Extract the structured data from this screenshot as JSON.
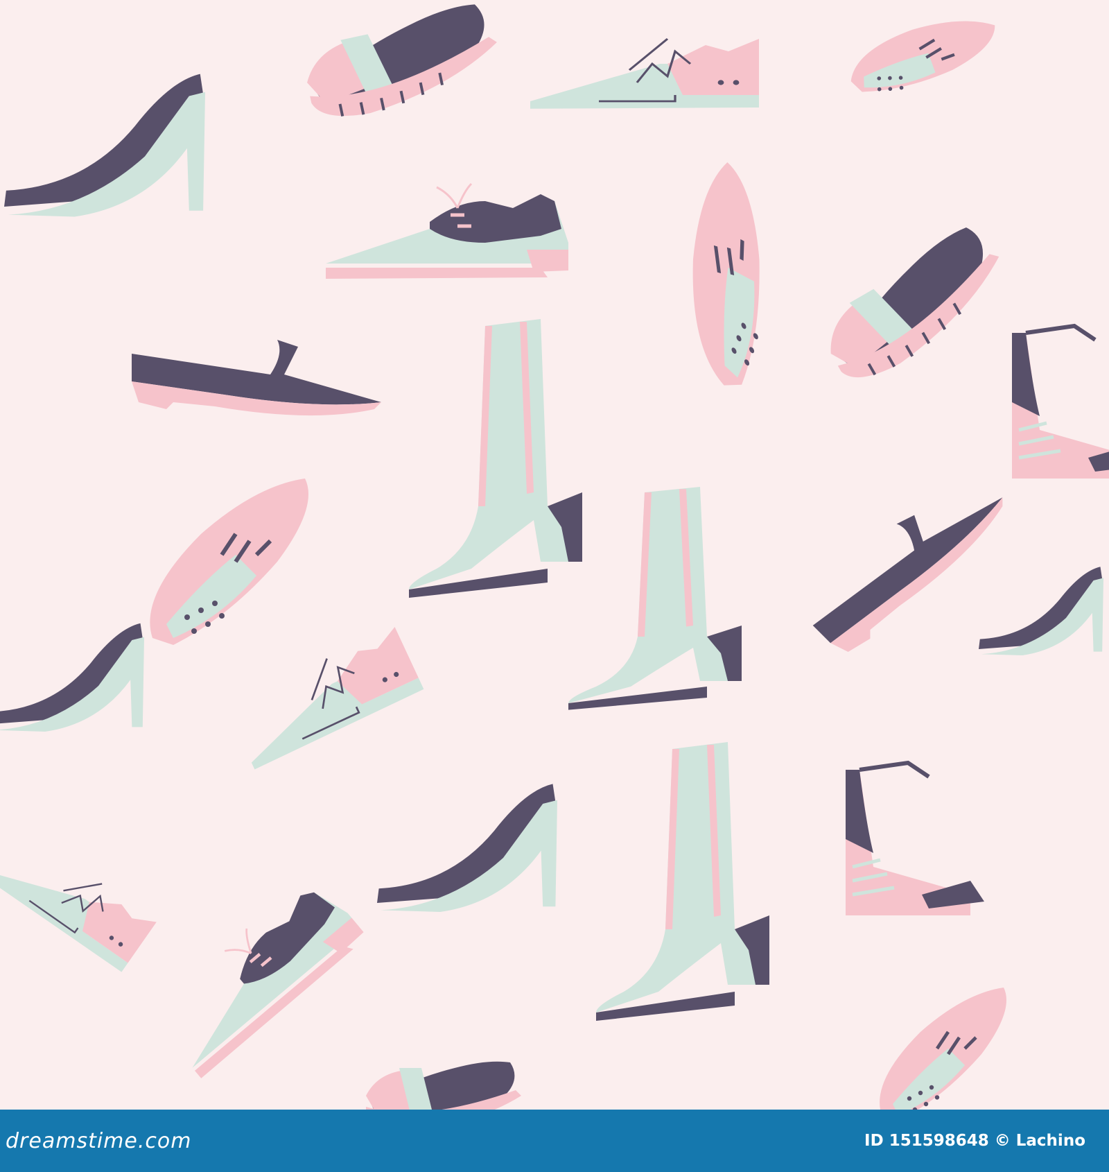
{
  "colors": {
    "background": "#fbeeee",
    "pink": "#f6c3cb",
    "mint": "#cfe4dc",
    "plum": "#58506a",
    "footer": "#1578ae",
    "footer_text": "#ffffff"
  },
  "pattern": {
    "subject": "seamless pattern of pastel women's shoes",
    "shoe_types": [
      "high-heel-pump",
      "loafer-sandal",
      "lace-up-sneaker",
      "oxford",
      "ballet-flat",
      "ankle-boot",
      "mule",
      "strappy-sandal"
    ]
  },
  "footer": {
    "brand": "dreamstime.com",
    "id_text": "ID 151598648 © Lachino"
  }
}
